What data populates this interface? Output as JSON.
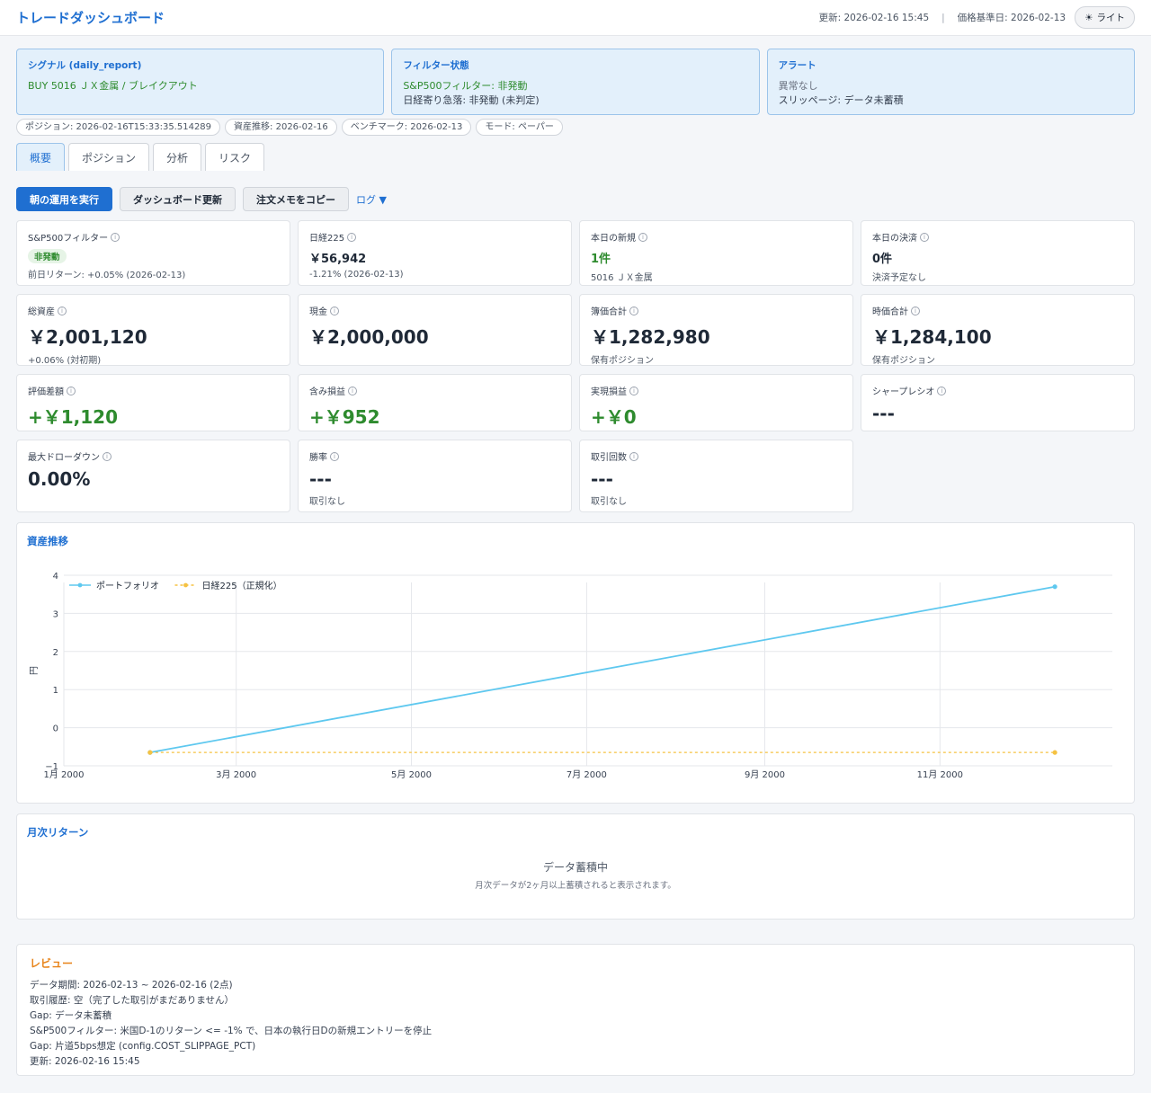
{
  "header": {
    "title": "トレードダッシュボード",
    "updated": "更新: 2026-02-16 15:45",
    "separator": "|",
    "price_date": "価格基準日: 2026-02-13",
    "theme_icon": "☀",
    "theme_label": "ライト"
  },
  "banners": {
    "signal": {
      "title": "シグナル (daily_report)",
      "line1": "BUY 5016 ＪＸ金属 / ブレイクアウト"
    },
    "filter": {
      "title": "フィルター状態",
      "line1": "S&P500フィルター: 非発動",
      "line2": "日経寄り急落: 非発動 (未判定)"
    },
    "alert": {
      "title": "アラート",
      "line1": "異常なし",
      "line2": "スリッページ: データ未蓄積"
    }
  },
  "chips": [
    "ポジション: 2026-02-16T15:33:35.514289",
    "資産推移: 2026-02-16",
    "ベンチマーク: 2026-02-13",
    "モード: ペーパー"
  ],
  "tabs": [
    "概要",
    "ポジション",
    "分析",
    "リスク"
  ],
  "actions": {
    "run": "朝の運用を実行",
    "refresh": "ダッシュボード更新",
    "copy": "注文メモをコピー",
    "log": "ログ ▼"
  },
  "info_glyph": "i",
  "cards": {
    "sp500": {
      "label": "S&P500フィルター",
      "badge": "非発動",
      "sub": "前日リターン: +0.05% (2026-02-13)"
    },
    "nikkei": {
      "label": "日経225",
      "value": "￥56,942",
      "sub": "-1.21% (2026-02-13)"
    },
    "new_today": {
      "label": "本日の新規",
      "value": "1件",
      "sub": "5016 ＪＸ金属"
    },
    "settle_today": {
      "label": "本日の決済",
      "value": "0件",
      "sub": "決済予定なし"
    },
    "total_assets": {
      "label": "総資産",
      "value": "￥2,001,120",
      "sub": "+0.06% (対初期)"
    },
    "cash": {
      "label": "現金",
      "value": "￥2,000,000"
    },
    "book_total": {
      "label": "簿価合計",
      "value": "￥1,282,980",
      "sub": "保有ポジション"
    },
    "market_total": {
      "label": "時価合計",
      "value": "￥1,284,100",
      "sub": "保有ポジション"
    },
    "valuation_diff": {
      "label": "評価差額",
      "value": "+￥1,120"
    },
    "unrealized": {
      "label": "含み損益",
      "value": "+￥952"
    },
    "realized": {
      "label": "実現損益",
      "value": "+￥0"
    },
    "sharpe": {
      "label": "シャープレシオ",
      "value": "---"
    },
    "max_dd": {
      "label": "最大ドローダウン",
      "value": "0.00%"
    },
    "win_rate": {
      "label": "勝率",
      "value": "---",
      "sub": "取引なし"
    },
    "trades": {
      "label": "取引回数",
      "value": "---",
      "sub": "取引なし"
    }
  },
  "chart_panel": {
    "title": "資産推移"
  },
  "chart_data": {
    "type": "line",
    "title": "",
    "xlabel": "",
    "ylabel": "円",
    "ylim": [
      -1,
      4
    ],
    "yticks": [
      -1,
      0,
      1,
      2,
      3,
      4
    ],
    "xlim": [
      "2000-01-01",
      "2000-12-31"
    ],
    "xticks": [
      {
        "label": "1月 2000",
        "value": "2000-01-01"
      },
      {
        "label": "3月 2000",
        "value": "2000-03-01"
      },
      {
        "label": "5月 2000",
        "value": "2000-05-01"
      },
      {
        "label": "7月 2000",
        "value": "2000-07-01"
      },
      {
        "label": "9月 2000",
        "value": "2000-09-01"
      },
      {
        "label": "11月 2000",
        "value": "2000-11-01"
      }
    ],
    "legend_position": "top-left",
    "grid": true,
    "series": [
      {
        "name": "ポートフォリオ",
        "color": "#5ec8ef",
        "style": "solid",
        "points": [
          [
            "2000-01-31",
            -0.65
          ],
          [
            "2000-12-11",
            3.7
          ]
        ]
      },
      {
        "name": "日経225（正規化）",
        "color": "#f5c242",
        "style": "dashed",
        "points": [
          [
            "2000-01-31",
            -0.65
          ],
          [
            "2000-12-11",
            -0.65
          ]
        ]
      }
    ]
  },
  "monthly": {
    "title": "月次リターン",
    "empty_title": "データ蓄積中",
    "empty_sub": "月次データが2ヶ月以上蓄積されると表示されます。"
  },
  "review": {
    "title": "レビュー",
    "lines": [
      "データ期間: 2026-02-13 ~ 2026-02-16 (2点)",
      "取引履歴: 空（完了した取引がまだありません）",
      "Gap: データ未蓄積",
      "S&P500フィルター: 米国D-1のリターン <= -1% で、日本の執行日Dの新規エントリーを停止",
      "Gap: 片道5bps想定 (config.COST_SLIPPAGE_PCT)",
      "更新: 2026-02-16 15:45"
    ]
  }
}
